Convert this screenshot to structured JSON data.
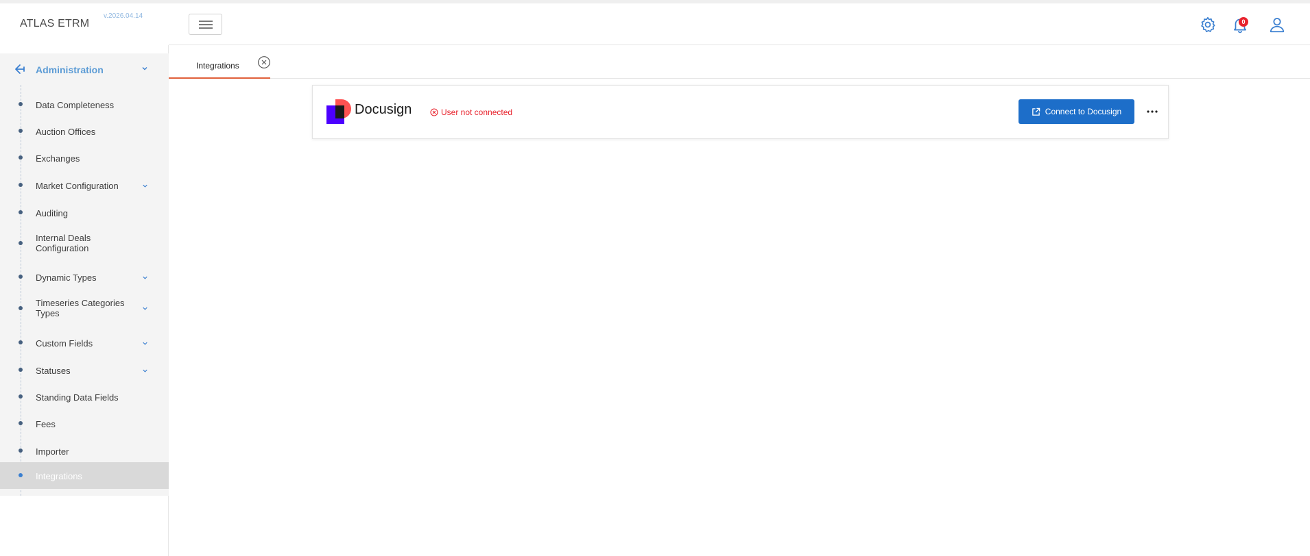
{
  "app": {
    "brand": "ATLAS ETRM",
    "version": "v.2026.04.14"
  },
  "topbar": {
    "menu_icon": "hamburger-icon",
    "settings_icon": "gear-icon",
    "notifications_icon": "bell-icon",
    "notifications_count": "0",
    "profile_icon": "user-icon"
  },
  "sidebar": {
    "section_label": "Administration",
    "items": [
      {
        "label": "Data Completeness",
        "expandable": false
      },
      {
        "label": "Auction Offices",
        "expandable": false
      },
      {
        "label": "Exchanges",
        "expandable": false
      },
      {
        "label": "Market Configuration",
        "expandable": true
      },
      {
        "label": "Auditing",
        "expandable": false
      },
      {
        "label": "Internal Deals Configuration",
        "expandable": false
      },
      {
        "label": "Dynamic Types",
        "expandable": true
      },
      {
        "label": "Timeseries Categories Types",
        "expandable": true
      },
      {
        "label": "Custom Fields",
        "expandable": true
      },
      {
        "label": "Statuses",
        "expandable": true
      },
      {
        "label": "Standing Data Fields",
        "expandable": false
      },
      {
        "label": "Fees",
        "expandable": false
      },
      {
        "label": "Importer",
        "expandable": false
      },
      {
        "label": "Integrations",
        "expandable": false,
        "active": true
      }
    ]
  },
  "tabs": [
    {
      "label": "Integrations",
      "active": true
    }
  ],
  "integration": {
    "name": "Docusign",
    "status": "User not connected",
    "connect_label": "Connect to Docusign",
    "more_icon": "more-horizontal-icon"
  },
  "colors": {
    "accent": "#1d6ec9",
    "tab_underline": "#e0603a",
    "error": "#e8232d",
    "section_label": "#5b9bd5"
  }
}
